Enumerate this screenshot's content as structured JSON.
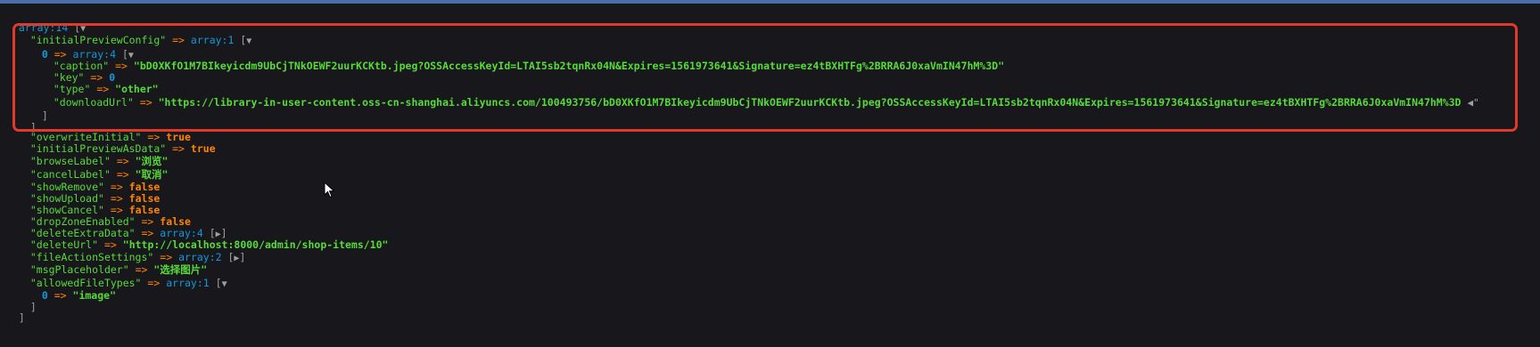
{
  "root": {
    "label": "array:14",
    "open": "[",
    "toggle": "▼",
    "close": "]"
  },
  "entries": [
    {
      "key": "\"initialPreviewConfig\"",
      "arrow": "=>",
      "type": "array:1",
      "open": "[",
      "toggle": "▼"
    },
    {
      "key": "0",
      "arrow": "=>",
      "type": "array:4",
      "open": "[",
      "toggle": "▼"
    },
    {
      "key": "\"caption\"",
      "arrow": "=>",
      "value": "\"bD0XKfO1M7BIkeyicdm9UbCjTNkOEWF2uurKCKtb.jpeg?OSSAccessKeyId=LTAI5sb2tqnRx04N&Expires=1561973641&Signature=ez4tBXHTFg%2BRRA6J0xaVmIN47hM%3D\""
    },
    {
      "key": "\"key\"",
      "arrow": "=>",
      "value": "0"
    },
    {
      "key": "\"type\"",
      "arrow": "=>",
      "value": "\"other\""
    },
    {
      "key": "\"downloadUrl\"",
      "arrow": "=>",
      "value": "\"https://library-in-user-content.oss-cn-shanghai.aliyuncs.com/100493756/bD0XKfO1M7BIkeyicdm9UbCjTNkOEWF2uurKCKtb.jpeg?OSSAccessKeyId=LTAI5sb2tqnRx04N&Expires=1561973641&Signature=ez4tBXHTFg%2BRRA6J0xaVmIN47hM%3D",
      "more": "◀\""
    },
    {
      "close": "]"
    },
    {
      "close": "]"
    },
    {
      "key": "\"overwriteInitial\"",
      "arrow": "=>",
      "value": "true"
    },
    {
      "key": "\"initialPreviewAsData\"",
      "arrow": "=>",
      "value": "true"
    },
    {
      "key": "\"browseLabel\"",
      "arrow": "=>",
      "value": "\"浏览\""
    },
    {
      "key": "\"cancelLabel\"",
      "arrow": "=>",
      "value": "\"取消\""
    },
    {
      "key": "\"showRemove\"",
      "arrow": "=>",
      "value": "false"
    },
    {
      "key": "\"showUpload\"",
      "arrow": "=>",
      "value": "false"
    },
    {
      "key": "\"showCancel\"",
      "arrow": "=>",
      "value": "false"
    },
    {
      "key": "\"dropZoneEnabled\"",
      "arrow": "=>",
      "value": "false"
    },
    {
      "key": "\"deleteExtraData\"",
      "arrow": "=>",
      "type": "array:4",
      "open": "[",
      "toggle": "▶",
      "close": "]"
    },
    {
      "key": "\"deleteUrl\"",
      "arrow": "=>",
      "value": "\"http://localhost:8000/admin/shop-items/10\""
    },
    {
      "key": "\"fileActionSettings\"",
      "arrow": "=>",
      "type": "array:2",
      "open": "[",
      "toggle": "▶",
      "close": "]"
    },
    {
      "key": "\"msgPlaceholder\"",
      "arrow": "=>",
      "value": "\"选择图片\""
    },
    {
      "key": "\"allowedFileTypes\"",
      "arrow": "=>",
      "type": "array:1",
      "open": "[",
      "toggle": "▼"
    },
    {
      "key": "0",
      "arrow": "=>",
      "value": "\"image\""
    },
    {
      "close": "]"
    }
  ],
  "colors": {
    "highlight_border": "#e23a2a",
    "background": "#18171b"
  }
}
